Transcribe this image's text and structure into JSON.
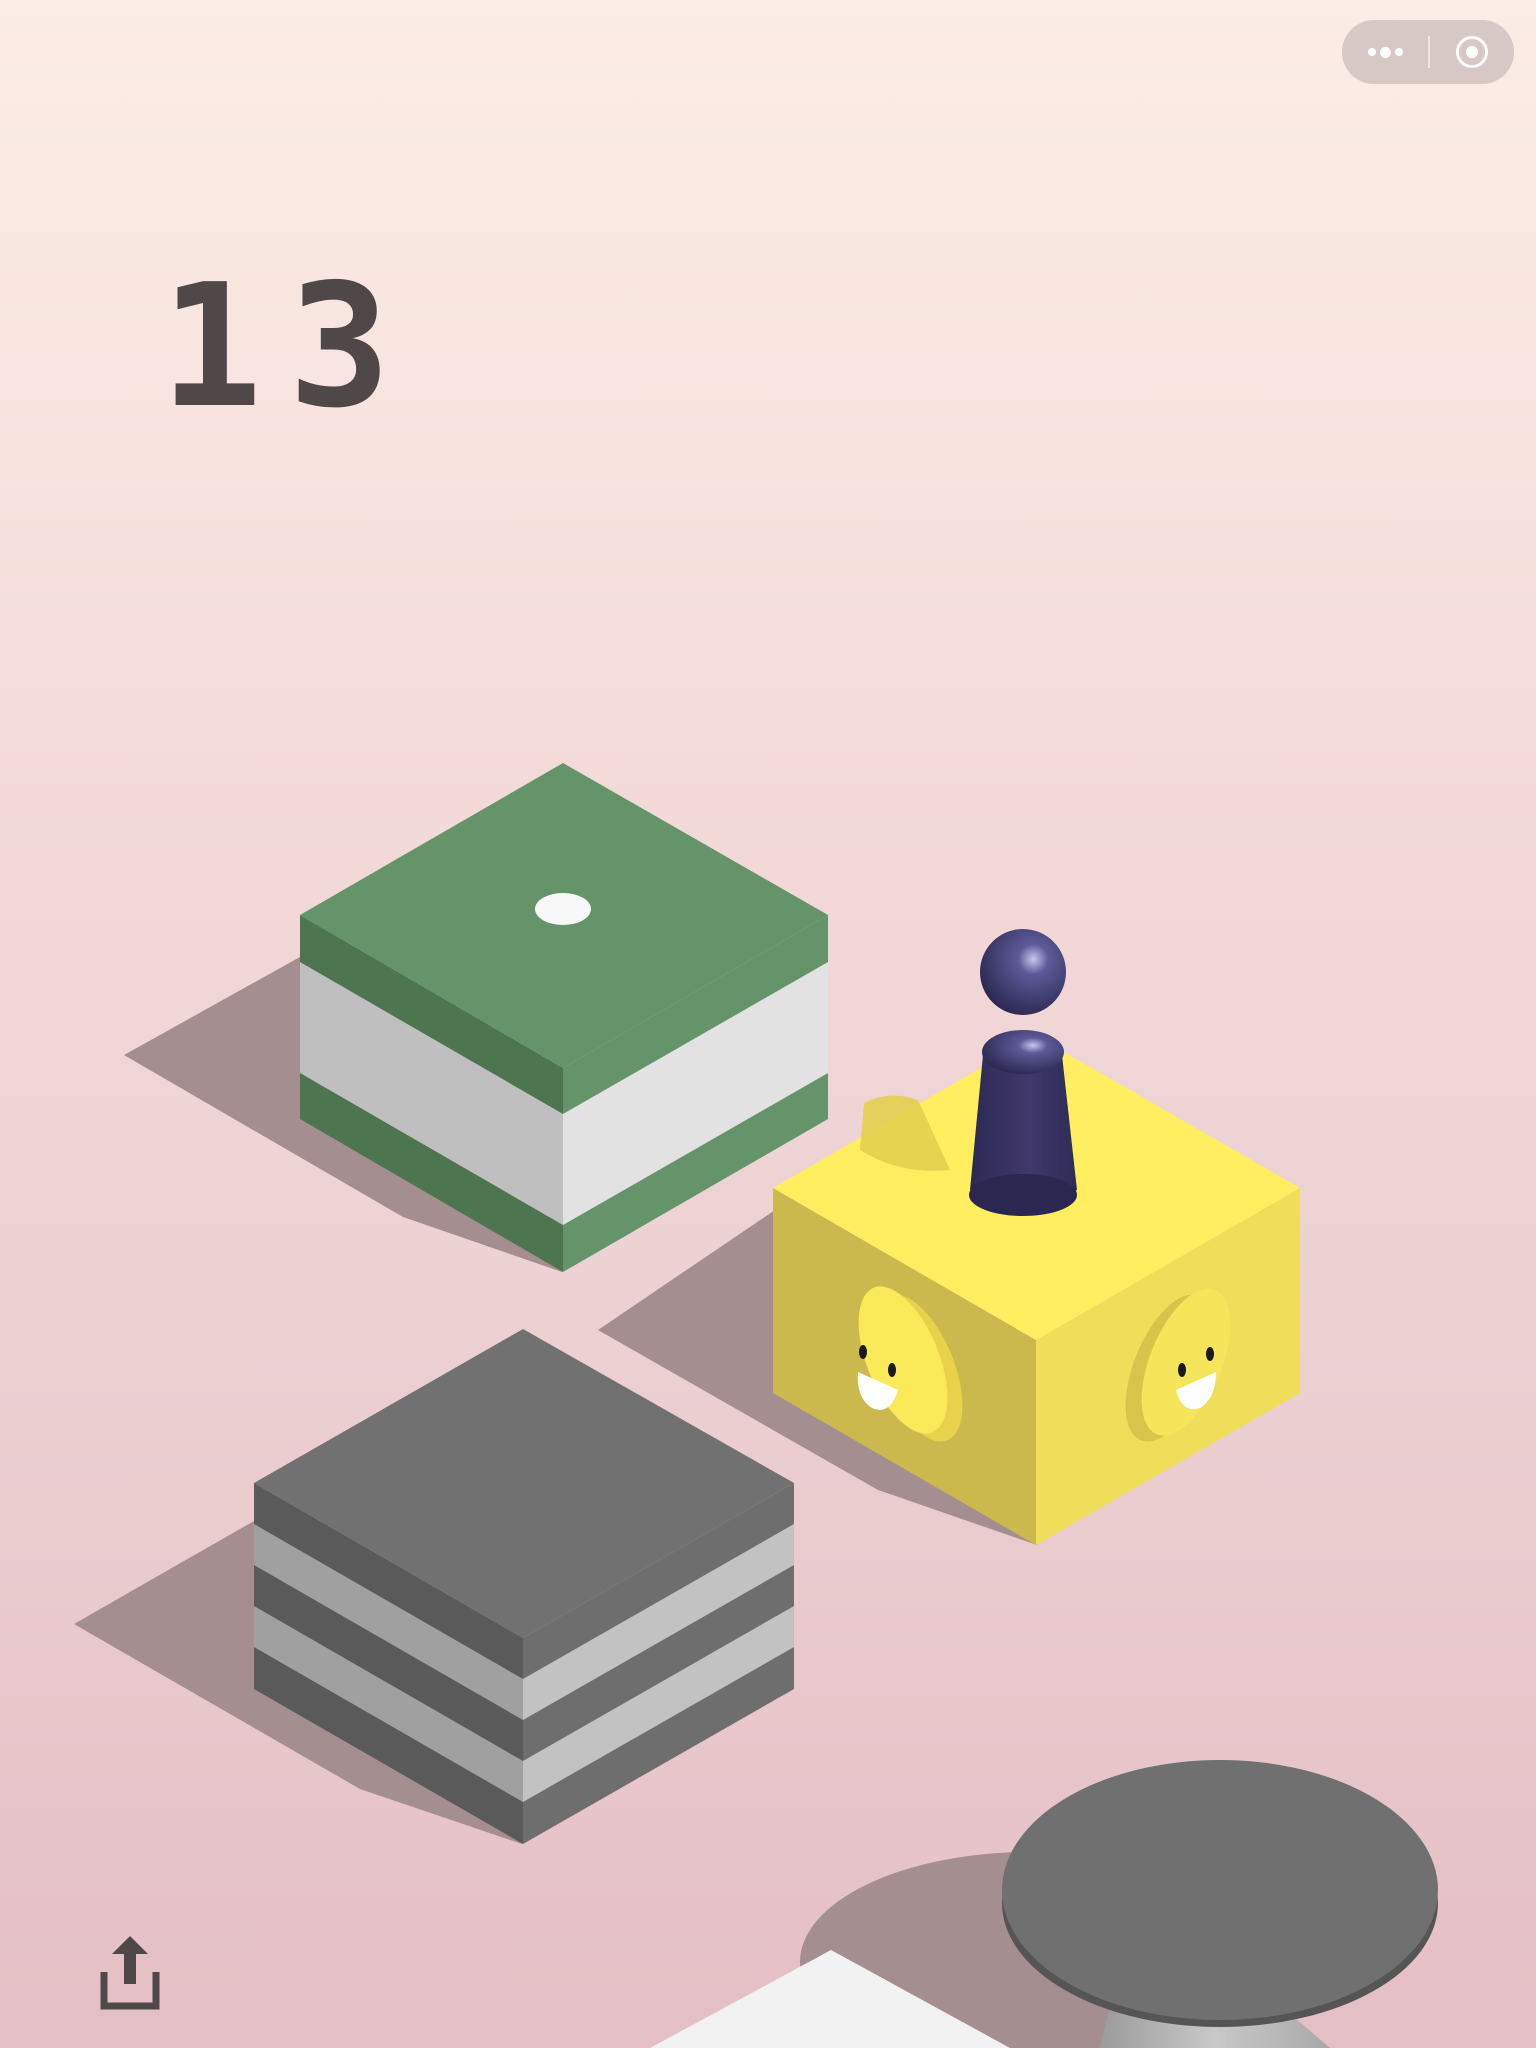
{
  "game": {
    "score": "13"
  },
  "top_capsule": {
    "menu_icon": "more-dots-icon",
    "close_icon": "target-close-icon"
  },
  "share": {
    "icon": "share-upload-icon"
  },
  "colors": {
    "background_top": "#fcede6",
    "background_bottom": "#e4bfc5",
    "score_text": "#504848",
    "green_block": "#66946a",
    "yellow_block": "#ffef60",
    "gray_block": "#717171",
    "player": "#3a3464"
  }
}
